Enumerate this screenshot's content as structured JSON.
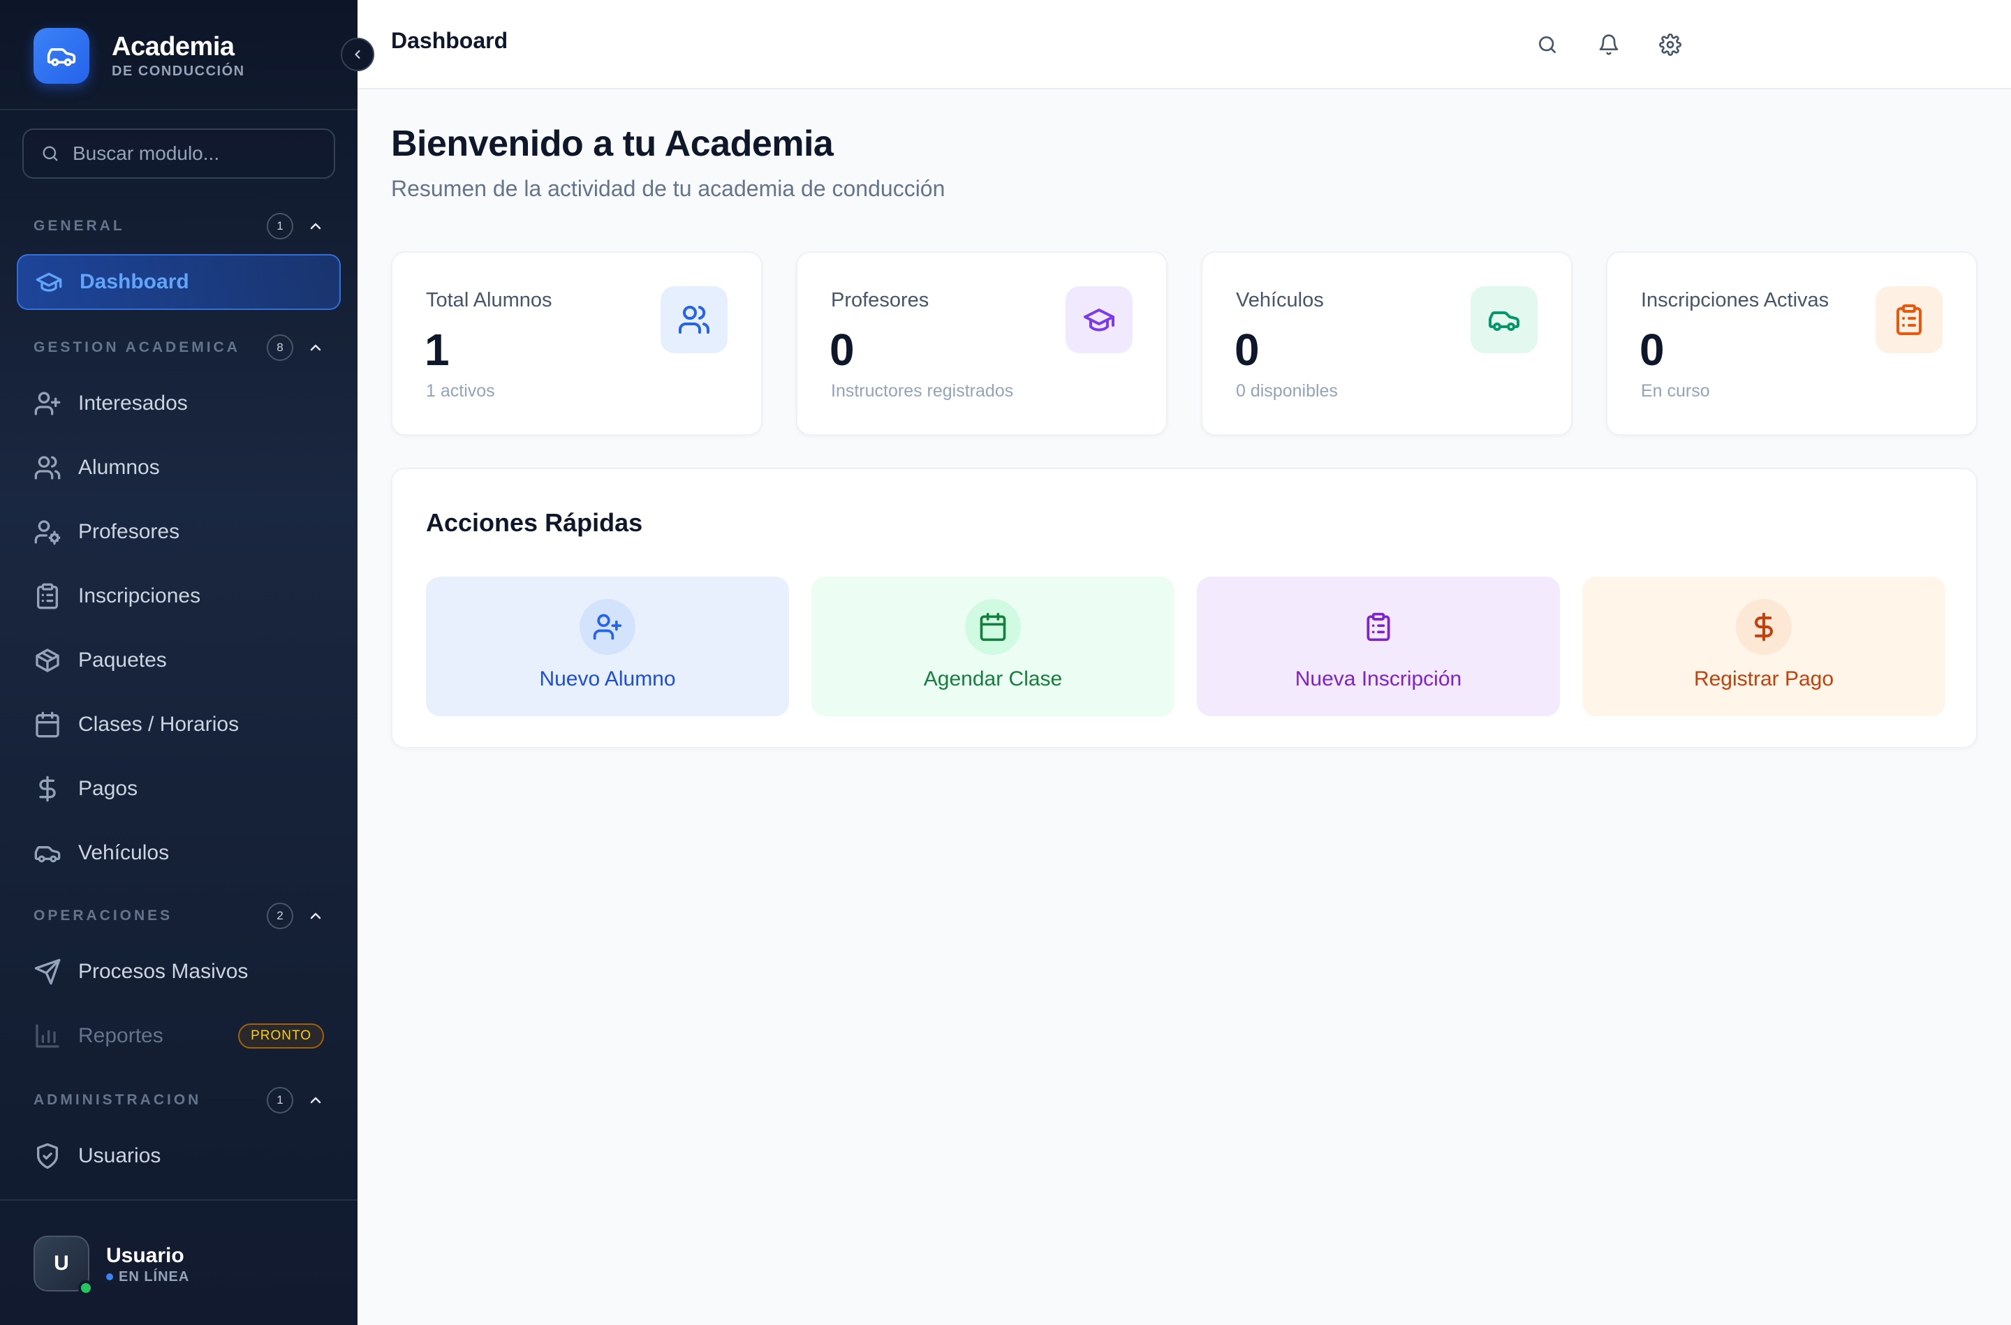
{
  "sidebar": {
    "brand": {
      "title": "Academia",
      "subtitle": "DE CONDUCCIÓN"
    },
    "search": {
      "placeholder": "Buscar modulo..."
    },
    "sections": [
      {
        "title": "GENERAL",
        "count": "1"
      },
      {
        "title": "GESTION ACADEMICA",
        "count": "8"
      },
      {
        "title": "OPERACIONES",
        "count": "2"
      },
      {
        "title": "ADMINISTRACION",
        "count": "1"
      }
    ],
    "items": {
      "dashboard": "Dashboard",
      "interesados": "Interesados",
      "alumnos": "Alumnos",
      "profesores": "Profesores",
      "inscripciones": "Inscripciones",
      "paquetes": "Paquetes",
      "clases": "Clases / Horarios",
      "pagos": "Pagos",
      "vehiculos": "Vehículos",
      "procesos": "Procesos Masivos",
      "reportes": "Reportes",
      "reportes_badge": "PRONTO",
      "usuarios": "Usuarios"
    },
    "user": {
      "initial": "U",
      "name": "Usuario",
      "status": "EN LÍNEA"
    }
  },
  "topbar": {
    "title": "Dashboard"
  },
  "main": {
    "title": "Bienvenido a tu Academia",
    "subtitle": "Resumen de la actividad de tu academia de conducción",
    "stats": [
      {
        "label": "Total Alumnos",
        "value": "1",
        "note": "1 activos",
        "icon": "users-icon"
      },
      {
        "label": "Profesores",
        "value": "0",
        "note": "Instructores registrados",
        "icon": "graduation-cap-icon"
      },
      {
        "label": "Vehículos",
        "value": "0",
        "note": "0 disponibles",
        "icon": "car-icon"
      },
      {
        "label": "Inscripciones Activas",
        "value": "0",
        "note": "En curso",
        "icon": "clipboard-icon"
      }
    ],
    "quick_actions": {
      "title": "Acciones Rápidas",
      "items": [
        {
          "label": "Nuevo Alumno",
          "icon": "user-plus-icon"
        },
        {
          "label": "Agendar Clase",
          "icon": "calendar-icon"
        },
        {
          "label": "Nueva Inscripción",
          "icon": "clipboard-list-icon"
        },
        {
          "label": "Registrar Pago",
          "icon": "dollar-icon"
        }
      ]
    }
  },
  "colors": {
    "accent": "#2563eb",
    "sidebar_bg": "#1a2740",
    "blue": "#2563eb",
    "purple": "#7c3aed",
    "green": "#059669",
    "orange": "#ea580c"
  }
}
